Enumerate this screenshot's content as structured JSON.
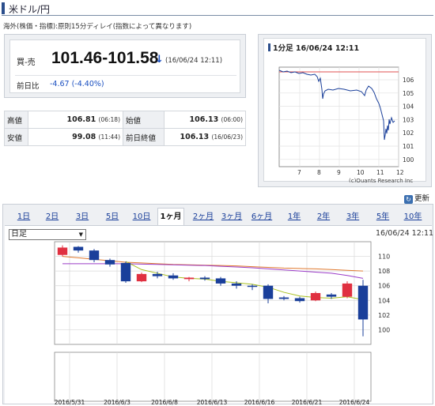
{
  "page_title": "米ドル/円",
  "note": "海外(株価・指標):原則15分ディレイ(指数によって異なります)",
  "quote": {
    "bid_ask_label": "買-売",
    "price": "101.46-101.58",
    "direction_icon": "down-arrow-icon",
    "time": "(16/06/24 12:11)",
    "prev_label": "前日比",
    "change": "-4.67 (-4.40%)",
    "down_color": "#1a4fc0"
  },
  "ohlc": {
    "high_label": "高値",
    "high_value": "106.81",
    "high_time": "(06:18)",
    "open_label": "始値",
    "open_value": "106.13",
    "open_time": "(06:00)",
    "low_label": "安値",
    "low_value": "99.08",
    "low_time": "(11:44)",
    "prev_close_label": "前日終値",
    "prev_close_value": "106.13",
    "prev_close_time": "(16/06/23)"
  },
  "mini_chart": {
    "title": "1分足 16/06/24 12:11",
    "credit": "(c)Quants Research Inc",
    "y_ticks": [
      "106",
      "105",
      "104",
      "103",
      "102",
      "101",
      "100"
    ],
    "x_ticks": [
      "7",
      "8",
      "9",
      "10",
      "11",
      "12"
    ]
  },
  "refresh_label": "更新",
  "tabs": [
    "1日",
    "2日",
    "3日",
    "5日",
    "10日",
    "1ヶ月",
    "2ヶ月",
    "3ヶ月",
    "6ヶ月",
    "1年",
    "2年",
    "3年",
    "5年",
    "10年"
  ],
  "active_tab": "1ヶ月",
  "selector_value": "日足",
  "chart_time": "16/06/24 12:11",
  "chart_data": {
    "type": "candlestick",
    "ylim": [
      98,
      112
    ],
    "y_ticks": [
      100,
      102,
      104,
      106,
      108,
      110
    ],
    "x_labels": [
      "2016/5/31",
      "2016/6/3",
      "2016/6/8",
      "2016/6/13",
      "2016/6/16",
      "2016/6/21",
      "2016/6/24"
    ],
    "up_color": "#e03040",
    "down_color": "#1a3f9a",
    "candles": [
      {
        "open": 110.2,
        "close": 111.2,
        "high": 111.5,
        "low": 110.0
      },
      {
        "open": 111.3,
        "close": 110.8,
        "high": 111.4,
        "low": 110.5
      },
      {
        "open": 110.8,
        "close": 109.5,
        "high": 111.0,
        "low": 109.2
      },
      {
        "open": 109.5,
        "close": 108.9,
        "high": 109.7,
        "low": 108.6
      },
      {
        "open": 109.1,
        "close": 106.6,
        "high": 109.3,
        "low": 106.4
      },
      {
        "open": 106.6,
        "close": 107.6,
        "high": 107.8,
        "low": 106.5
      },
      {
        "open": 107.6,
        "close": 107.3,
        "high": 107.9,
        "low": 107.0
      },
      {
        "open": 107.4,
        "close": 107.0,
        "high": 107.7,
        "low": 106.8
      },
      {
        "open": 106.9,
        "close": 107.1,
        "high": 107.2,
        "low": 106.6
      },
      {
        "open": 107.1,
        "close": 106.9,
        "high": 107.3,
        "low": 106.7
      },
      {
        "open": 107.0,
        "close": 106.3,
        "high": 107.2,
        "low": 106.0
      },
      {
        "open": 106.3,
        "close": 106.0,
        "high": 106.6,
        "low": 105.6
      },
      {
        "open": 106.0,
        "close": 105.9,
        "high": 106.2,
        "low": 105.4
      },
      {
        "open": 106.0,
        "close": 104.2,
        "high": 106.2,
        "low": 103.6
      },
      {
        "open": 104.4,
        "close": 104.2,
        "high": 104.6,
        "low": 104.0
      },
      {
        "open": 104.3,
        "close": 103.9,
        "high": 104.5,
        "low": 103.7
      },
      {
        "open": 104.0,
        "close": 105.0,
        "high": 105.2,
        "low": 103.9
      },
      {
        "open": 104.8,
        "close": 104.5,
        "high": 105.0,
        "low": 104.2
      },
      {
        "open": 104.5,
        "close": 106.3,
        "high": 106.6,
        "low": 104.3
      },
      {
        "open": 106.0,
        "close": 101.4,
        "high": 106.8,
        "low": 99.1
      }
    ],
    "ma_lines": [
      {
        "name": "",
        "color": "#e07a30",
        "values": [
          110.0,
          109.8,
          109.6,
          109.4,
          109.2,
          109.1,
          109.0,
          108.9,
          108.85,
          108.8,
          108.75,
          108.7,
          108.6,
          108.5,
          108.4,
          108.35,
          108.3,
          108.2,
          108.1,
          108.0
        ]
      },
      {
        "name": "",
        "color": "#9b3cc8",
        "values": [
          109.0,
          109.0,
          109.0,
          109.0,
          109.0,
          108.95,
          108.9,
          108.85,
          108.8,
          108.75,
          108.65,
          108.55,
          108.45,
          108.3,
          108.15,
          108.0,
          107.85,
          107.7,
          107.4,
          107.0
        ]
      },
      {
        "name": "",
        "color": "#a8c020",
        "values": [
          null,
          null,
          null,
          null,
          109.3,
          108.2,
          107.7,
          107.2,
          107.0,
          106.9,
          106.6,
          106.4,
          106.2,
          105.8,
          105.1,
          104.6,
          104.4,
          104.3,
          104.5,
          104.1
        ]
      }
    ]
  }
}
